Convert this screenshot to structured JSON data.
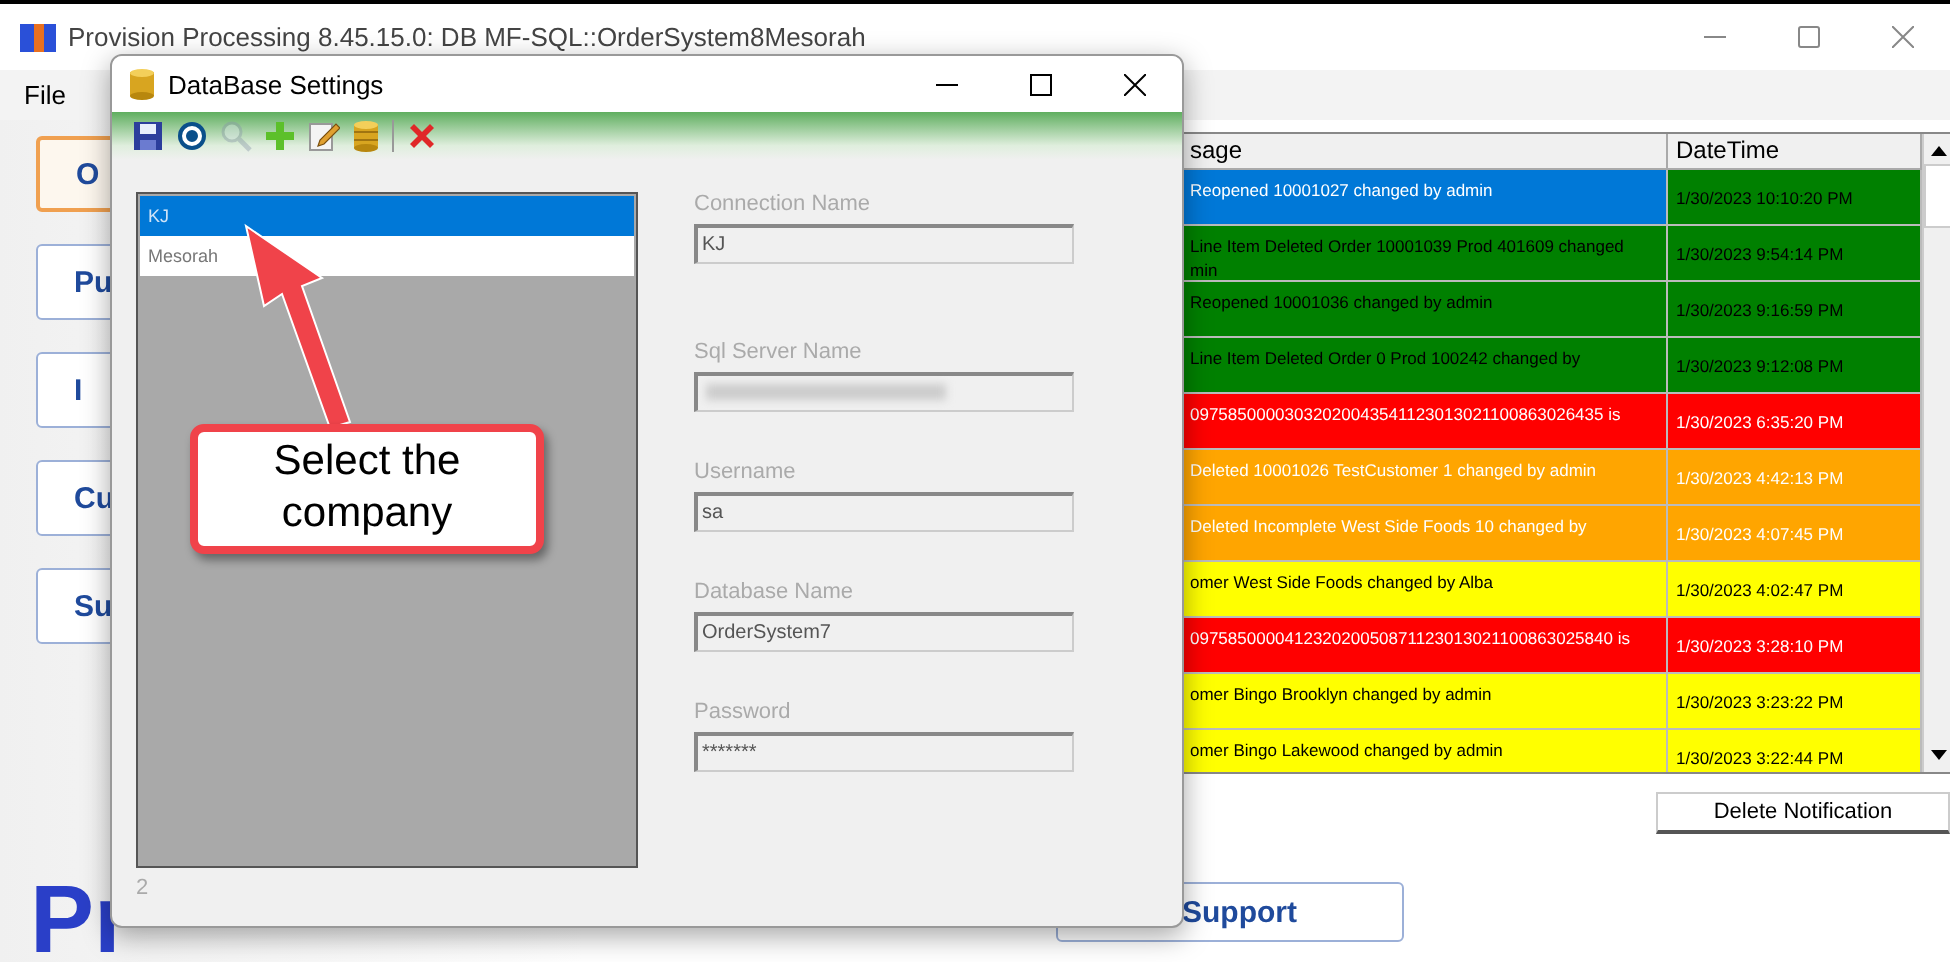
{
  "main_window": {
    "title": "Provision Processing 8.45.15.0: DB MF-SQL::OrderSystem8Mesorah",
    "menu": [
      "File"
    ]
  },
  "nav_buttons": [
    {
      "label": "O",
      "selected": true
    },
    {
      "label": "Pu",
      "selected": false
    },
    {
      "label": "I",
      "selected": false
    },
    {
      "label": "Cu",
      "selected": false
    },
    {
      "label": "Su",
      "selected": false
    }
  ],
  "logo": {
    "text": "Pr"
  },
  "support_button": "Support",
  "notifications": {
    "columns": [
      "sage",
      "DateTime"
    ],
    "rows": [
      {
        "message": "Reopened 10001027 changed by admin",
        "datetime": "1/30/2023 10:10:20 PM",
        "color": "#008000",
        "selected": true
      },
      {
        "message": "Line Item Deleted Order 10001039 Prod 401609 changed\nmin",
        "datetime": "1/30/2023 9:54:14 PM",
        "color": "#008000",
        "selected": false
      },
      {
        "message": "Reopened 10001036 changed by admin",
        "datetime": "1/30/2023 9:16:59 PM",
        "color": "#008000",
        "selected": false
      },
      {
        "message": "Line Item Deleted Order 0 Prod 100242 changed by",
        "datetime": "1/30/2023 9:12:08 PM",
        "color": "#008000",
        "selected": false
      },
      {
        "message": "09758500003032020043541123013021100863026435 is",
        "datetime": "1/30/2023 6:35:20 PM",
        "color": "#ff0000",
        "selected": false
      },
      {
        "message": "Deleted 10001026 TestCustomer 1 changed by admin",
        "datetime": "1/30/2023 4:42:13 PM",
        "color": "#ffa500",
        "selected": false
      },
      {
        "message": "Deleted Incomplete West Side Foods 10 changed by",
        "datetime": "1/30/2023 4:07:45 PM",
        "color": "#ffa500",
        "selected": false
      },
      {
        "message": "omer West Side Foods changed by Alba",
        "datetime": "1/30/2023 4:02:47 PM",
        "color": "#ffff00",
        "selected": false
      },
      {
        "message": "097585000041232020050871123013021100863025840 is",
        "datetime": "1/30/2023 3:28:10 PM",
        "color": "#ff0000",
        "selected": false
      },
      {
        "message": "omer Bingo Brooklyn changed by admin",
        "datetime": "1/30/2023 3:23:22 PM",
        "color": "#ffff00",
        "selected": false
      },
      {
        "message": "omer Bingo Lakewood changed by admin",
        "datetime": "1/30/2023 3:22:44 PM",
        "color": "#ffff00",
        "selected": false
      }
    ]
  },
  "delete_button": "Delete Notification",
  "dialog": {
    "title": "DataBase Settings",
    "toolbar": [
      {
        "kind": "save",
        "disabled": false
      },
      {
        "kind": "target",
        "disabled": false
      },
      {
        "kind": "search",
        "disabled": true
      },
      {
        "kind": "add",
        "disabled": false
      },
      {
        "kind": "edit",
        "disabled": false
      },
      {
        "kind": "database",
        "disabled": false
      },
      {
        "kind": "delete",
        "disabled": false
      }
    ],
    "companies": [
      {
        "name": "KJ",
        "selected": true
      },
      {
        "name": "Mesorah",
        "selected": false
      }
    ],
    "count": "2",
    "fields": [
      {
        "label": "Connection Name",
        "value": "KJ",
        "kind": "text"
      },
      {
        "label": "Sql Server Name",
        "kind": "blurred"
      },
      {
        "label": "Username",
        "value": "sa",
        "kind": "text"
      },
      {
        "label": "Database Name",
        "value": "OrderSystem7",
        "kind": "text"
      },
      {
        "label": "Password",
        "value": "*******",
        "kind": "text"
      }
    ]
  },
  "callout": {
    "text": "Select the company"
  }
}
